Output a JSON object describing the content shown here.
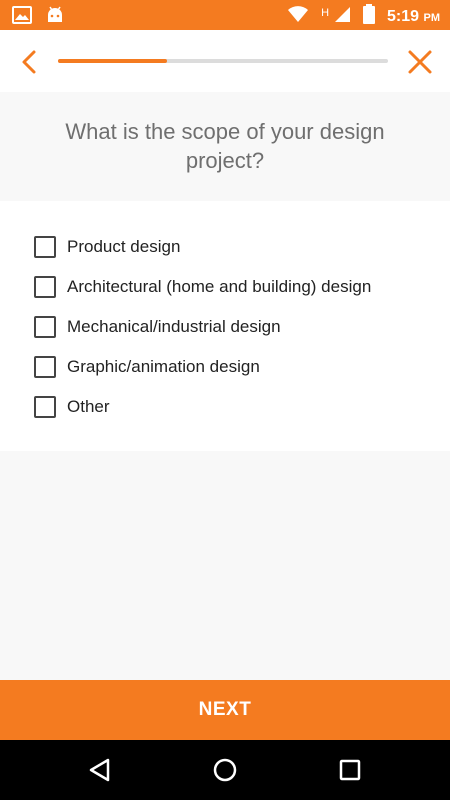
{
  "status_bar": {
    "time": "5:19",
    "time_suffix": "PM",
    "network_label": "H",
    "icons_left": [
      "image-icon",
      "android-icon"
    ],
    "icons_right": [
      "wifi-icon",
      "signal-icon",
      "battery-icon"
    ]
  },
  "toolbar": {
    "back_icon": "chevron-left-icon",
    "close_icon": "close-icon",
    "progress": 0.33
  },
  "question": {
    "text": "What is the scope of your design project?"
  },
  "options": [
    {
      "label": "Product design",
      "checked": false
    },
    {
      "label": "Architectural (home and building) design",
      "checked": false
    },
    {
      "label": "Mechanical/industrial design",
      "checked": false
    },
    {
      "label": "Graphic/animation design",
      "checked": false
    },
    {
      "label": "Other",
      "checked": false
    }
  ],
  "footer": {
    "next_label": "NEXT"
  },
  "nav_bar": {
    "icons": [
      "back-triangle-icon",
      "home-circle-icon",
      "recents-square-icon"
    ]
  },
  "colors": {
    "accent": "#f47b20",
    "question_text": "#6f6f6f",
    "option_text": "#222222"
  }
}
